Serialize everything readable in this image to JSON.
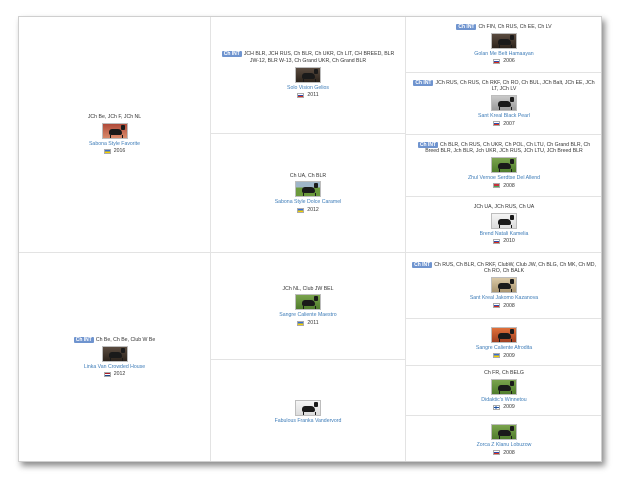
{
  "badge": "Ch INT",
  "gen1": [
    {
      "badge": false,
      "titles": "JCh Be, JCh F, JCh NL",
      "name": "Sabona Style Favorite",
      "year": "2016",
      "flag": "ua",
      "photo": "red"
    },
    {
      "badge": true,
      "titles": "Ch Be, Ch Be, Club W Be",
      "name": "Linka Van Crowded House",
      "year": "2012",
      "flag": "nl",
      "photo": "dark"
    }
  ],
  "gen2": [
    {
      "badge": true,
      "titles": "JCH BLR, JCH RUS, Ch BLR, Ch UKR, Ch LIT, CH BREED, BLR JW-12, BLR W-13, Ch Grand UKR, Ch Grand BLR",
      "name": "Solo Vision Gelios",
      "year": "2011",
      "flag": "ru",
      "photo": "dark"
    },
    {
      "badge": false,
      "titles": "Ch UA, Ch BLR",
      "name": "Sabona Style Dolce Caramel",
      "year": "2012",
      "flag": "ua",
      "photo": "grass"
    },
    {
      "badge": false,
      "titles": "JCh NL, Club JW BEL",
      "name": "Sangre Caliente Maestro",
      "year": "2011",
      "flag": "ua",
      "photo": "green"
    },
    {
      "badge": false,
      "titles": "",
      "name": "Fabulous Franka Vandervord",
      "year": "",
      "flag": "",
      "photo": "white"
    }
  ],
  "gen3": [
    {
      "badge": true,
      "titles": "Ch FIN, Ch RUS, Ch EE, Ch LV",
      "name": "Golan Me Belt Hamaayan",
      "year": "2006",
      "flag": "ru",
      "photo": "dark"
    },
    {
      "badge": true,
      "titles": "JCh RUS, Ch RUS, Ch RKF, Ch RO, Ch BUL, JCh Balt, JCh EE, JCh LT, JCh LV",
      "name": "Sant Kreal Black Pearl",
      "year": "2007",
      "flag": "ru",
      "photo": "grey"
    },
    {
      "badge": true,
      "titles": "Ch BLR, Ch RUS, Ch UKR, Ch POL, Ch LTU, Ch Grand BLR, Ch Breed BLR, Jch BLR, Jch UKR, JCh RUS, JCh LTU, JCh Breed BLR",
      "name": "Zhul Vernoe Serdtse Del Allend",
      "year": "2008",
      "flag": "by",
      "photo": "green"
    },
    {
      "badge": false,
      "titles": "JCh UA, JCh RUS, Ch UA",
      "name": "Brend Natali Kamelia",
      "year": "2010",
      "flag": "ru",
      "photo": "white"
    },
    {
      "badge": true,
      "titles": "Ch RUS, Ch BLR, Ch RKF, ClubW, Club JW, Ch BLG, Ch MK, Ch MD, Ch RO, Ch BALK",
      "name": "Sant Kreal Jakomo Kazanova",
      "year": "2008",
      "flag": "ru",
      "photo": "sand"
    },
    {
      "badge": false,
      "titles": "",
      "name": "Sangre Caliente Afrodita",
      "year": "2009",
      "flag": "ua",
      "photo": "orange"
    },
    {
      "badge": false,
      "titles": "Ch FR, Ch BELG",
      "name": "Didaktic's Winnetou",
      "year": "2009",
      "flag": "fi",
      "photo": "green"
    },
    {
      "badge": false,
      "titles": "",
      "name": "Zorca Z Klanu Lobuzow",
      "year": "2008",
      "flag": "ru",
      "photo": "green"
    }
  ]
}
